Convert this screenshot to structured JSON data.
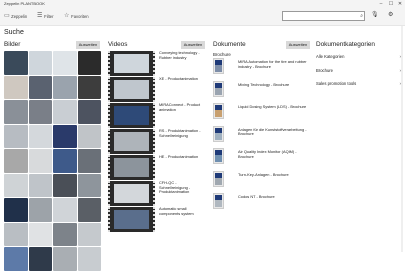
{
  "window": {
    "title": "Zeppelin PLANTBOOK",
    "minimize": "–",
    "maximize": "☐",
    "close": "✕"
  },
  "toolbar": {
    "items": [
      {
        "label": "Zeppelin",
        "icon": "folder-icon",
        "glyph": "▭"
      },
      {
        "label": "Filter",
        "icon": "filter-icon",
        "glyph": "☰"
      },
      {
        "label": "Favoriten",
        "icon": "star-icon",
        "glyph": "☆"
      }
    ],
    "search_placeholder": "",
    "search_glyph": "⌕",
    "right_icons": [
      {
        "name": "microphone-icon",
        "glyph": "🎙︎"
      },
      {
        "name": "settings-icon",
        "glyph": "⚙"
      }
    ]
  },
  "page_title": "Suche",
  "images": {
    "heading": "Bilder",
    "button": "Ausweiten",
    "tiles": [
      "#3a4a5a",
      "#cfd6dc",
      "#dfe4e8",
      "#2b2b2b",
      "#cfc8c0",
      "#5a6270",
      "#9aa3ad",
      "#3d3d3d",
      "#8a9098",
      "#7a7f88",
      "#c9ced3",
      "#4d5360",
      "#b7bcc2",
      "#d4d8dc",
      "#2a3a6a",
      "#c0c4c8",
      "#a8a8a8",
      "#d8dadc",
      "#3e5a8a",
      "#6a7078",
      "#cfd3d6",
      "#bfc4c9",
      "#4a4f57",
      "#8e959c",
      "#20304a",
      "#9da3a9",
      "#d0d4d8",
      "#5a5f66",
      "#b9bec3",
      "#e0e2e4",
      "#7d838a",
      "#c5c9cd",
      "#5d7aa8",
      "#2f3a4a",
      "#a9aeb3",
      "#c8ccd0"
    ]
  },
  "videos": {
    "heading": "Videos",
    "button": "Ausweiten",
    "items": [
      {
        "label": "Conveying technology - Rubber industry",
        "color": "#cfd6dc"
      },
      {
        "label": "XE - Productanimation",
        "color": "#bfc6cd"
      },
      {
        "label": "MIRAConnect - Product animation",
        "color": "#2e4a78"
      },
      {
        "label": "RS - Produktanimation - Schnellreinigung",
        "color": "#aeb4ba"
      },
      {
        "label": "HE - Productanimation",
        "color": "#8c949c"
      },
      {
        "label": "CFH-QC - Schnellreinigung - Produktanimation",
        "color": "#d3d7db"
      },
      {
        "label": "Automatic small components system",
        "color": "#5a6e8c"
      }
    ]
  },
  "documents": {
    "heading": "Dokumente",
    "button": "Ausweiten",
    "subheading": "Brochure",
    "items": [
      {
        "label": "MIRA Automation for the tire and rubber industry - Brochure",
        "band": "#1f3a78",
        "pic": "#7d8da8"
      },
      {
        "label": "Mixing Technology - Brochure",
        "band": "#1f3a78",
        "pic": "#9aa4b0"
      },
      {
        "label": "Liquid Dosing System (LDS) - Brochure",
        "band": "#1f3a78",
        "pic": "#c8a070"
      },
      {
        "label": "Anlagen für die Kunststoffverarbeitung - Brochure",
        "band": "#1f3a78",
        "pic": "#9fb0c0"
      },
      {
        "label": "Air Quality Index Monitor (AQIM) - Brochure",
        "band": "#1f3a78",
        "pic": "#6f8fb0"
      },
      {
        "label": "Turn-Key-Anlagen - Brochure",
        "band": "#1f3a78",
        "pic": "#a0a8b0"
      },
      {
        "label": "Codos NT - Brochure",
        "band": "#1f3a78",
        "pic": "#b0b8c0"
      }
    ]
  },
  "categories": {
    "heading": "Dokumentkategorien",
    "chevron": "›",
    "items": [
      "Alle Kategorien",
      "Brochure",
      "Sales promotion tools"
    ]
  }
}
